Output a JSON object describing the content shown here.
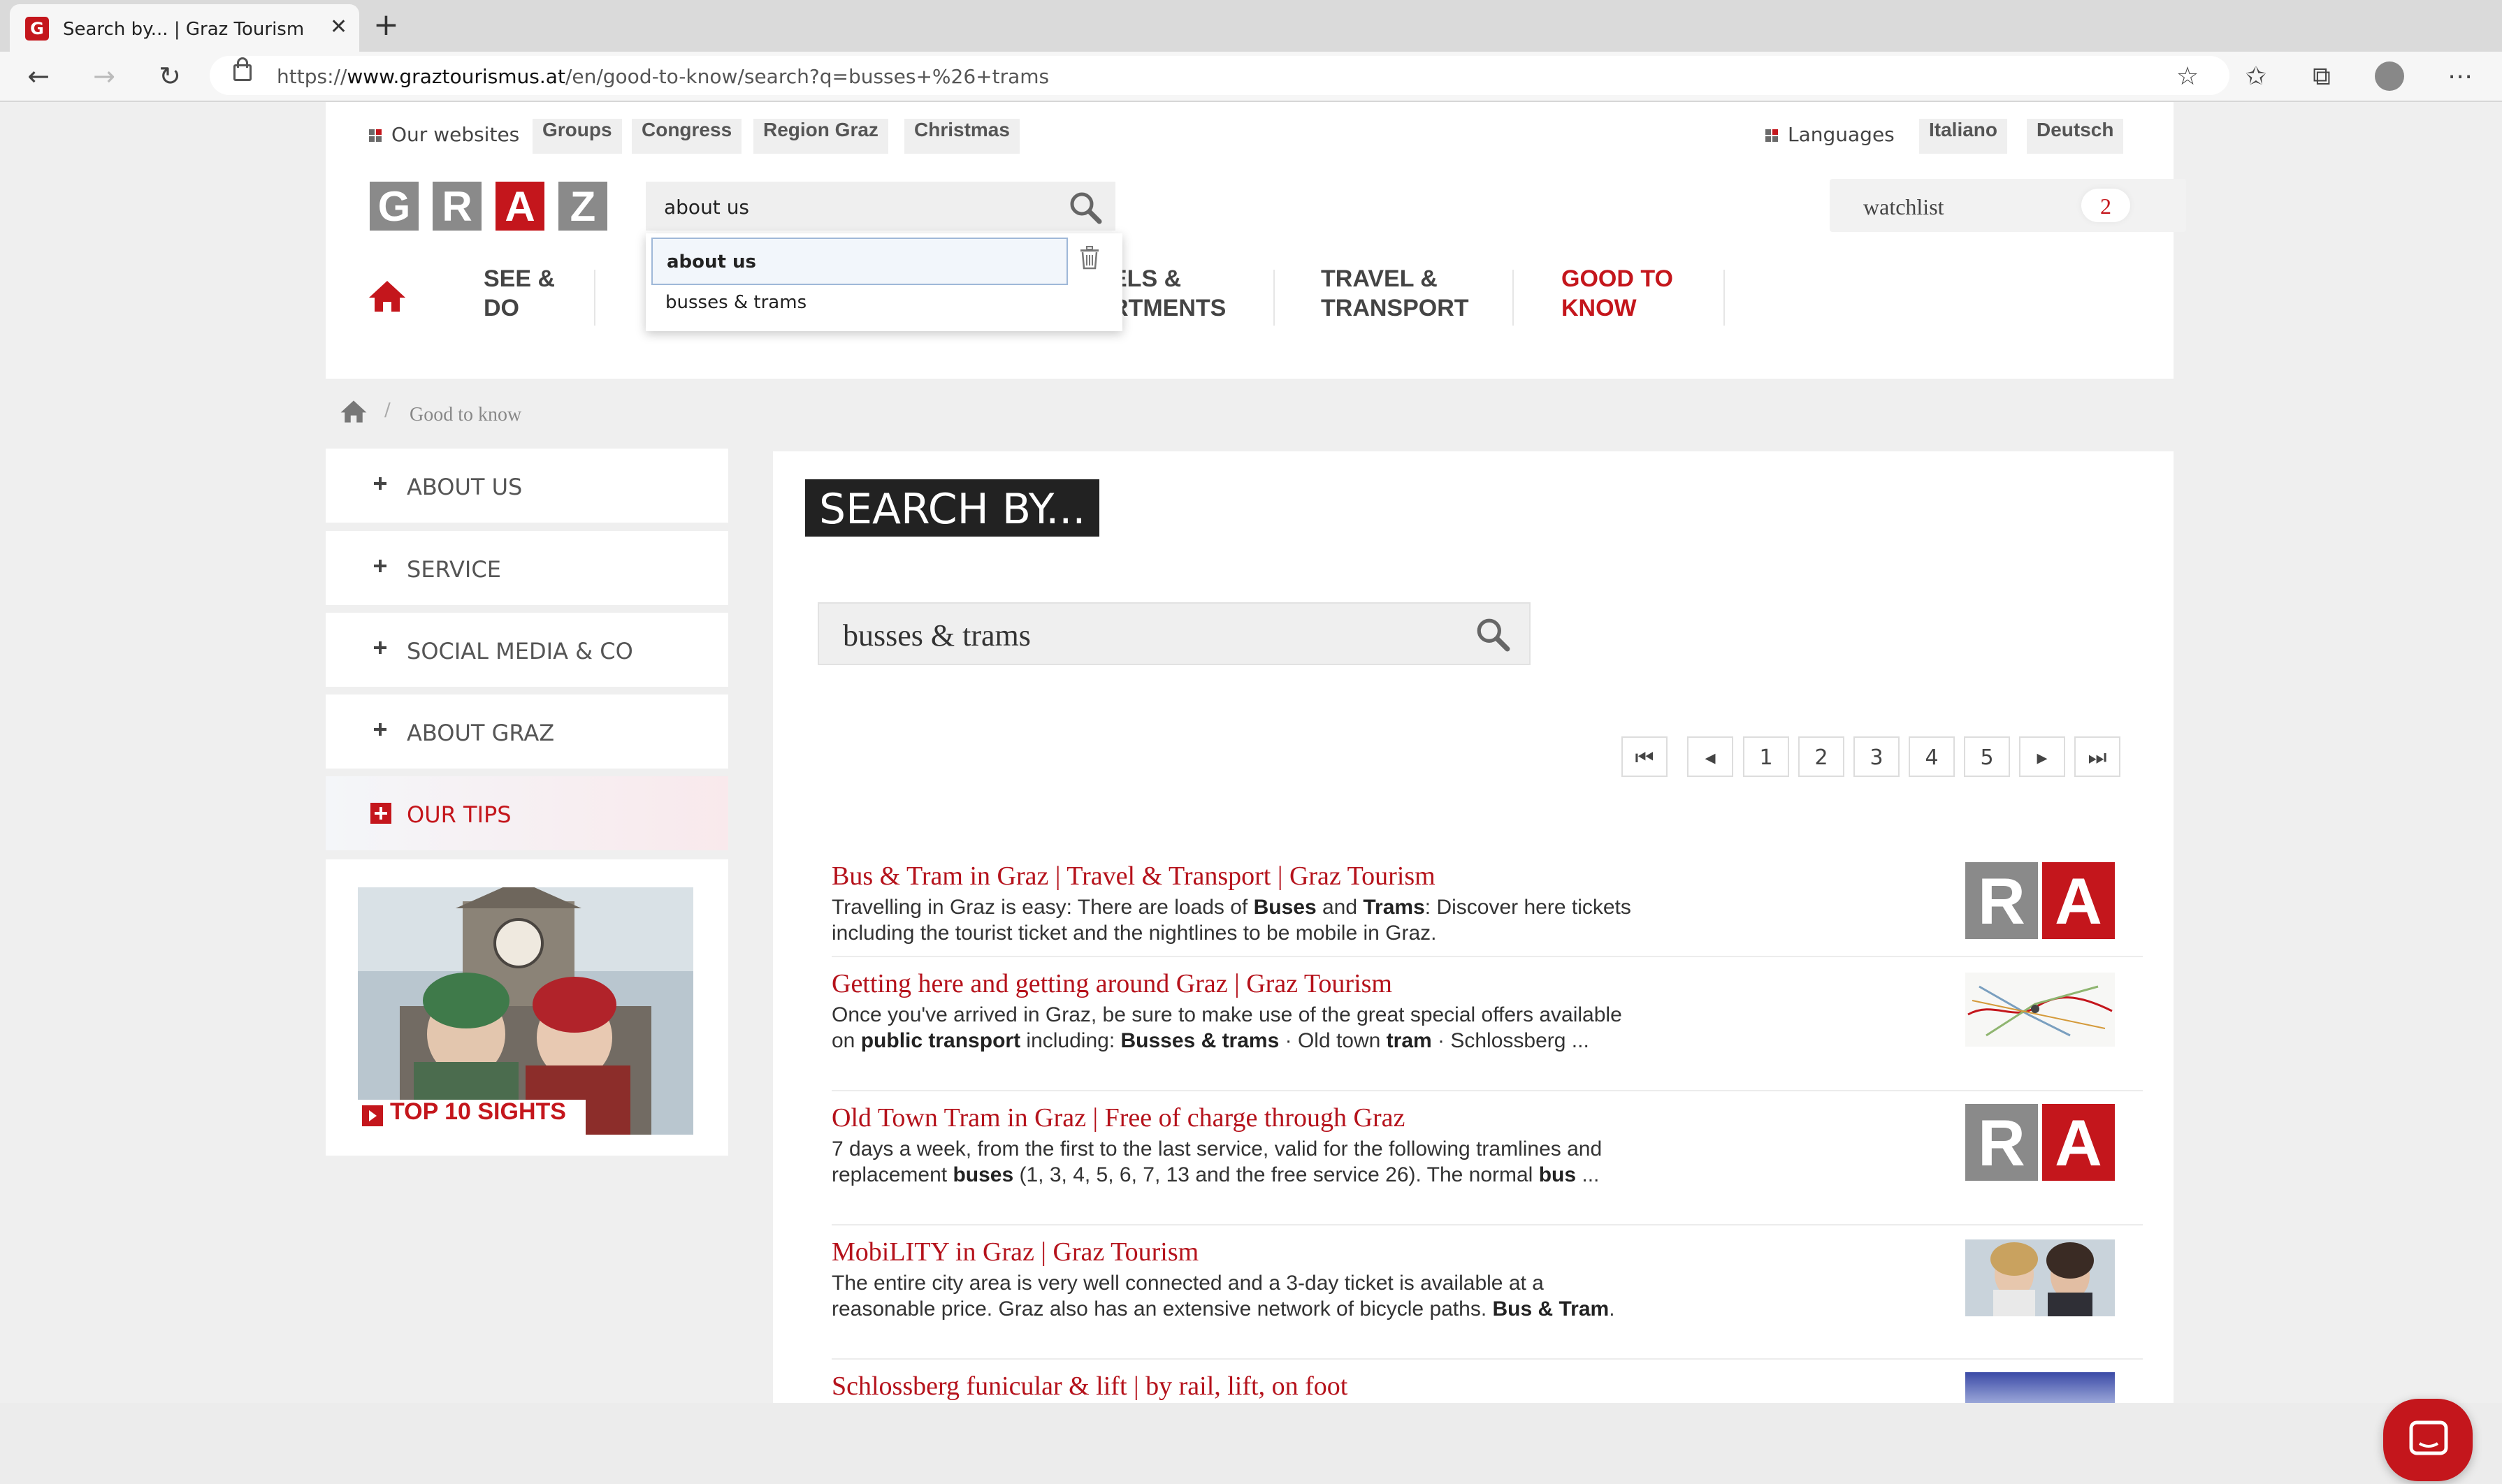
{
  "browser": {
    "tab_title": "Search by... | Graz Tourism",
    "tab_favicon": "G",
    "tab_close": "✕",
    "new_tab": "+",
    "url_prefix": "https://",
    "url_domain": "www.graztourismus.at",
    "url_path": "/en/good-to-know/search?q=busses+%26+trams"
  },
  "topbar": {
    "our_websites_label": "Our websites",
    "websites": [
      "Groups",
      "Congress",
      "Region Graz",
      "Christmas"
    ],
    "languages_label": "Languages",
    "languages": [
      "Italiano",
      "Deutsch"
    ]
  },
  "logo": [
    "G",
    "R",
    "A",
    "Z"
  ],
  "top_search": {
    "value": "about us",
    "suggestions": [
      "about us",
      "busses & trams"
    ]
  },
  "main_nav": {
    "items": [
      "SEE &\nDO",
      "ELS &\nRTMENTS",
      "TRAVEL &\nTRANSPORT",
      "GOOD TO\nKNOW"
    ]
  },
  "watchlist": {
    "label": "watchlist",
    "count": "2"
  },
  "breadcrumb": {
    "current": "Good to know"
  },
  "sidebar": {
    "items": [
      "ABOUT US",
      "SERVICE",
      "SOCIAL MEDIA & CO",
      "ABOUT GRAZ",
      "OUR TIPS"
    ],
    "tip_card_label": "TOP 10 SIGHTS"
  },
  "main": {
    "heading": "SEARCH BY...",
    "search_value": "busses & trams",
    "pagination": [
      "1",
      "2",
      "3",
      "4",
      "5"
    ],
    "results": [
      {
        "title": "Bus & Tram in Graz | Travel & Transport | Graz Tourism",
        "text": [
          {
            "t": "Travelling in Graz is easy: There are loads of "
          },
          {
            "b": "Buses"
          },
          {
            "t": " and "
          },
          {
            "b": "Trams"
          },
          {
            "t": ": Discover here tickets including the tourist ticket and the nightlines to be mobile in Graz."
          }
        ],
        "thumb": "ra"
      },
      {
        "title": "Getting here and getting around Graz | Graz Tourism",
        "text": [
          {
            "t": "Once you've arrived in Graz, be sure to make use of the great special offers available on "
          },
          {
            "b": "public transport"
          },
          {
            "t": " including: "
          },
          {
            "b": "Busses & trams"
          },
          {
            "t": " · Old town "
          },
          {
            "b": "tram"
          },
          {
            "t": " · Schlossberg ..."
          }
        ],
        "thumb": "map"
      },
      {
        "title": "Old Town Tram in Graz | Free of charge through Graz",
        "text": [
          {
            "t": "7 days a week, from the first to the last service, valid for the following tramlines and replacement "
          },
          {
            "b": "buses"
          },
          {
            "t": " (1, 3, 4, 5, 6, 7, 13 and the free service 26). The normal "
          },
          {
            "b": "bus"
          },
          {
            "t": " ..."
          }
        ],
        "thumb": "ra"
      },
      {
        "title": "MobiLITY in Graz | Graz Tourism",
        "text": [
          {
            "t": "The entire city area is very well connected and a 3-day ticket is available at a reasonable price. Graz also has an extensive network of bicycle paths. "
          },
          {
            "b": "Bus & Tram"
          },
          {
            "t": "."
          }
        ],
        "thumb": "photo"
      },
      {
        "title": "Schlossberg funicular & lift | by rail, lift, on foot",
        "text": [],
        "thumb": "sky"
      }
    ]
  },
  "colors": {
    "brand_red": "#c4161c",
    "link_red": "#b5121b",
    "logo_grey": "#8a8a8a"
  }
}
